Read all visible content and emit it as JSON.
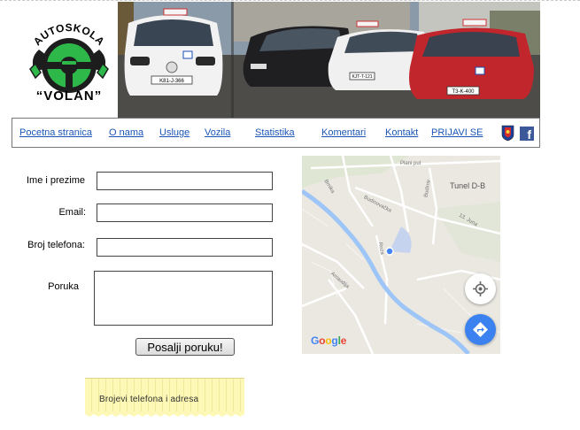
{
  "logo": {
    "top_text": "AUTOŠKOLA",
    "bottom_text": "“VOLAN”",
    "colors": {
      "wheel": "#1a1a1a",
      "green": "#2eb84a"
    }
  },
  "photo": {
    "plates": [
      "K81-J-366",
      "KJT-T-121",
      "T3-K-400"
    ]
  },
  "nav": {
    "items": [
      {
        "label": "Pocetna stranica"
      },
      {
        "label": "O nama"
      },
      {
        "label": "Usluge"
      },
      {
        "label": "Vozila"
      },
      {
        "label": "Statistika"
      },
      {
        "label": "Komentari"
      },
      {
        "label": "Kontakt"
      },
      {
        "label": "PRIJAVI SE"
      }
    ],
    "icons": [
      "flag-icon",
      "facebook-icon"
    ],
    "link_color": "#1b56b5"
  },
  "form": {
    "name_label": "Ime i prezime",
    "email_label": "Email:",
    "phone_label": "Broj telefona:",
    "message_label": "Poruka",
    "submit_label": "Posalji poruku!",
    "name_value": "",
    "email_value": "",
    "phone_value": "",
    "message_value": ""
  },
  "map": {
    "place": "Tunel D-B",
    "street_labels": [
      "Plani put",
      "Brnika",
      "Budinovačka",
      "Budimir",
      "13. Juna",
      "Roza",
      "Amaudija"
    ],
    "google_letters": [
      "G",
      "o",
      "o",
      "g",
      "l",
      "e"
    ],
    "colors": {
      "water": "#9ec5f7",
      "dot": "#4285f4",
      "button": "#3b82f0"
    }
  },
  "note": {
    "text": "Brojevi telefona i adresa",
    "color": "#fdf8b5"
  }
}
